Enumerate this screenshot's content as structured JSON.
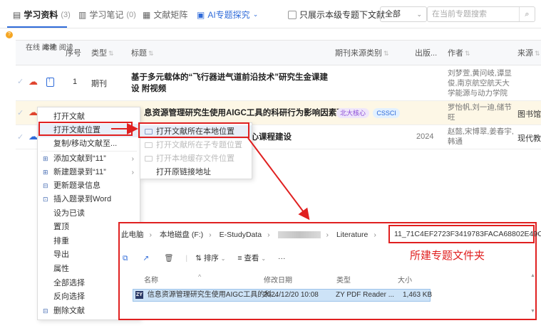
{
  "tabs": [
    {
      "label": "学习资料",
      "count": "(3)"
    },
    {
      "label": "学习笔记",
      "count": "(0)"
    },
    {
      "label": "文献矩阵",
      "count": ""
    },
    {
      "label": "AI专题探究",
      "count": ""
    }
  ],
  "filter": {
    "checkbox_label": "只展示本级专题下文献",
    "select_value": "全部",
    "search_placeholder": "在当前专题搜索"
  },
  "badge_count": "?",
  "table": {
    "headers": {
      "online_read": "在线 阅读",
      "local_read": "本地 阅读",
      "index": "序号",
      "type": "类型",
      "title": "标题",
      "journal_type": "期刊来源类别",
      "year": "出版...",
      "author": "作者",
      "source": "来源"
    },
    "rows": [
      {
        "index": "1",
        "type": "期刊",
        "title": "基于多元载体的“飞行器进气道前沿技术”研究生金课建设 附视频",
        "tags": [],
        "year": "",
        "author": "刘梦萱,黄问岐,谭显俊,南京航空航天大学能源与动力学院",
        "source": ""
      },
      {
        "index": "",
        "type": "",
        "title": "息资源管理研究生使用AIGC工具的科研行为影响因素研究",
        "tags": [
          "北大核心",
          "CSSCI"
        ],
        "year": "",
        "author": "罗怡帆,刘一迪,储节旺",
        "source": "图书馆"
      },
      {
        "index": "",
        "type": "",
        "title": "核心课程建设",
        "tags": [],
        "year": "2024",
        "author": "赵懿,宋博翠,姜春宇,韩通",
        "source": "现代教"
      }
    ]
  },
  "context_menu": [
    {
      "label": "打开文献",
      "submenu": false,
      "icon": ""
    },
    {
      "label": "打开文献位置",
      "submenu": true,
      "icon": ""
    },
    {
      "label": "复制/移动文献至...",
      "submenu": false,
      "icon": ""
    },
    {
      "label": "添加文献到“11”",
      "submenu": true,
      "icon": "plus-icon"
    },
    {
      "label": "新建题录到“11”",
      "submenu": true,
      "icon": "new-icon"
    },
    {
      "label": "更新题录信息",
      "submenu": false,
      "icon": "refresh-icon"
    },
    {
      "label": "插入题录到Word",
      "submenu": false,
      "icon": "word-icon"
    },
    {
      "label": "设为已读",
      "submenu": false,
      "icon": ""
    },
    {
      "label": "置顶",
      "submenu": false,
      "icon": ""
    },
    {
      "label": "排重",
      "submenu": false,
      "icon": ""
    },
    {
      "label": "导出",
      "submenu": false,
      "icon": ""
    },
    {
      "label": "属性",
      "submenu": false,
      "icon": ""
    },
    {
      "label": "全部选择",
      "submenu": false,
      "icon": ""
    },
    {
      "label": "反向选择",
      "submenu": false,
      "icon": ""
    },
    {
      "label": "删除文献",
      "submenu": false,
      "icon": "delete-icon"
    }
  ],
  "submenu": [
    {
      "label": "打开文献所在本地位置",
      "disabled": false
    },
    {
      "label": "打开文献所在子专题位置",
      "disabled": true
    },
    {
      "label": "打开本地缓存文件位置",
      "disabled": true
    },
    {
      "label": "打开原链接地址",
      "disabled": false
    }
  ],
  "explorer": {
    "breadcrumb": [
      "此电脑",
      "本地磁盘 (F:)",
      "E-StudyData",
      "",
      "Literature"
    ],
    "folder_name": "11_71C4EF2723F3419783FACA68802E49C1",
    "annotation": "所建专题文件夹",
    "toolbar": {
      "sort": "排序",
      "view": "查看",
      "more": "···"
    },
    "columns": {
      "name": "名称",
      "date": "修改日期",
      "type": "类型",
      "size": "大小"
    },
    "file": {
      "name": "信息资源管理研究生使用AIGC工具的科...",
      "date": "2024/12/20 10:08",
      "type": "ZY PDF Reader ...",
      "size": "1,463 KB"
    }
  },
  "colors": {
    "accent": "#2f6bd9",
    "highlight_red": "#e02020",
    "row_highlight": "#fdf7e6"
  }
}
